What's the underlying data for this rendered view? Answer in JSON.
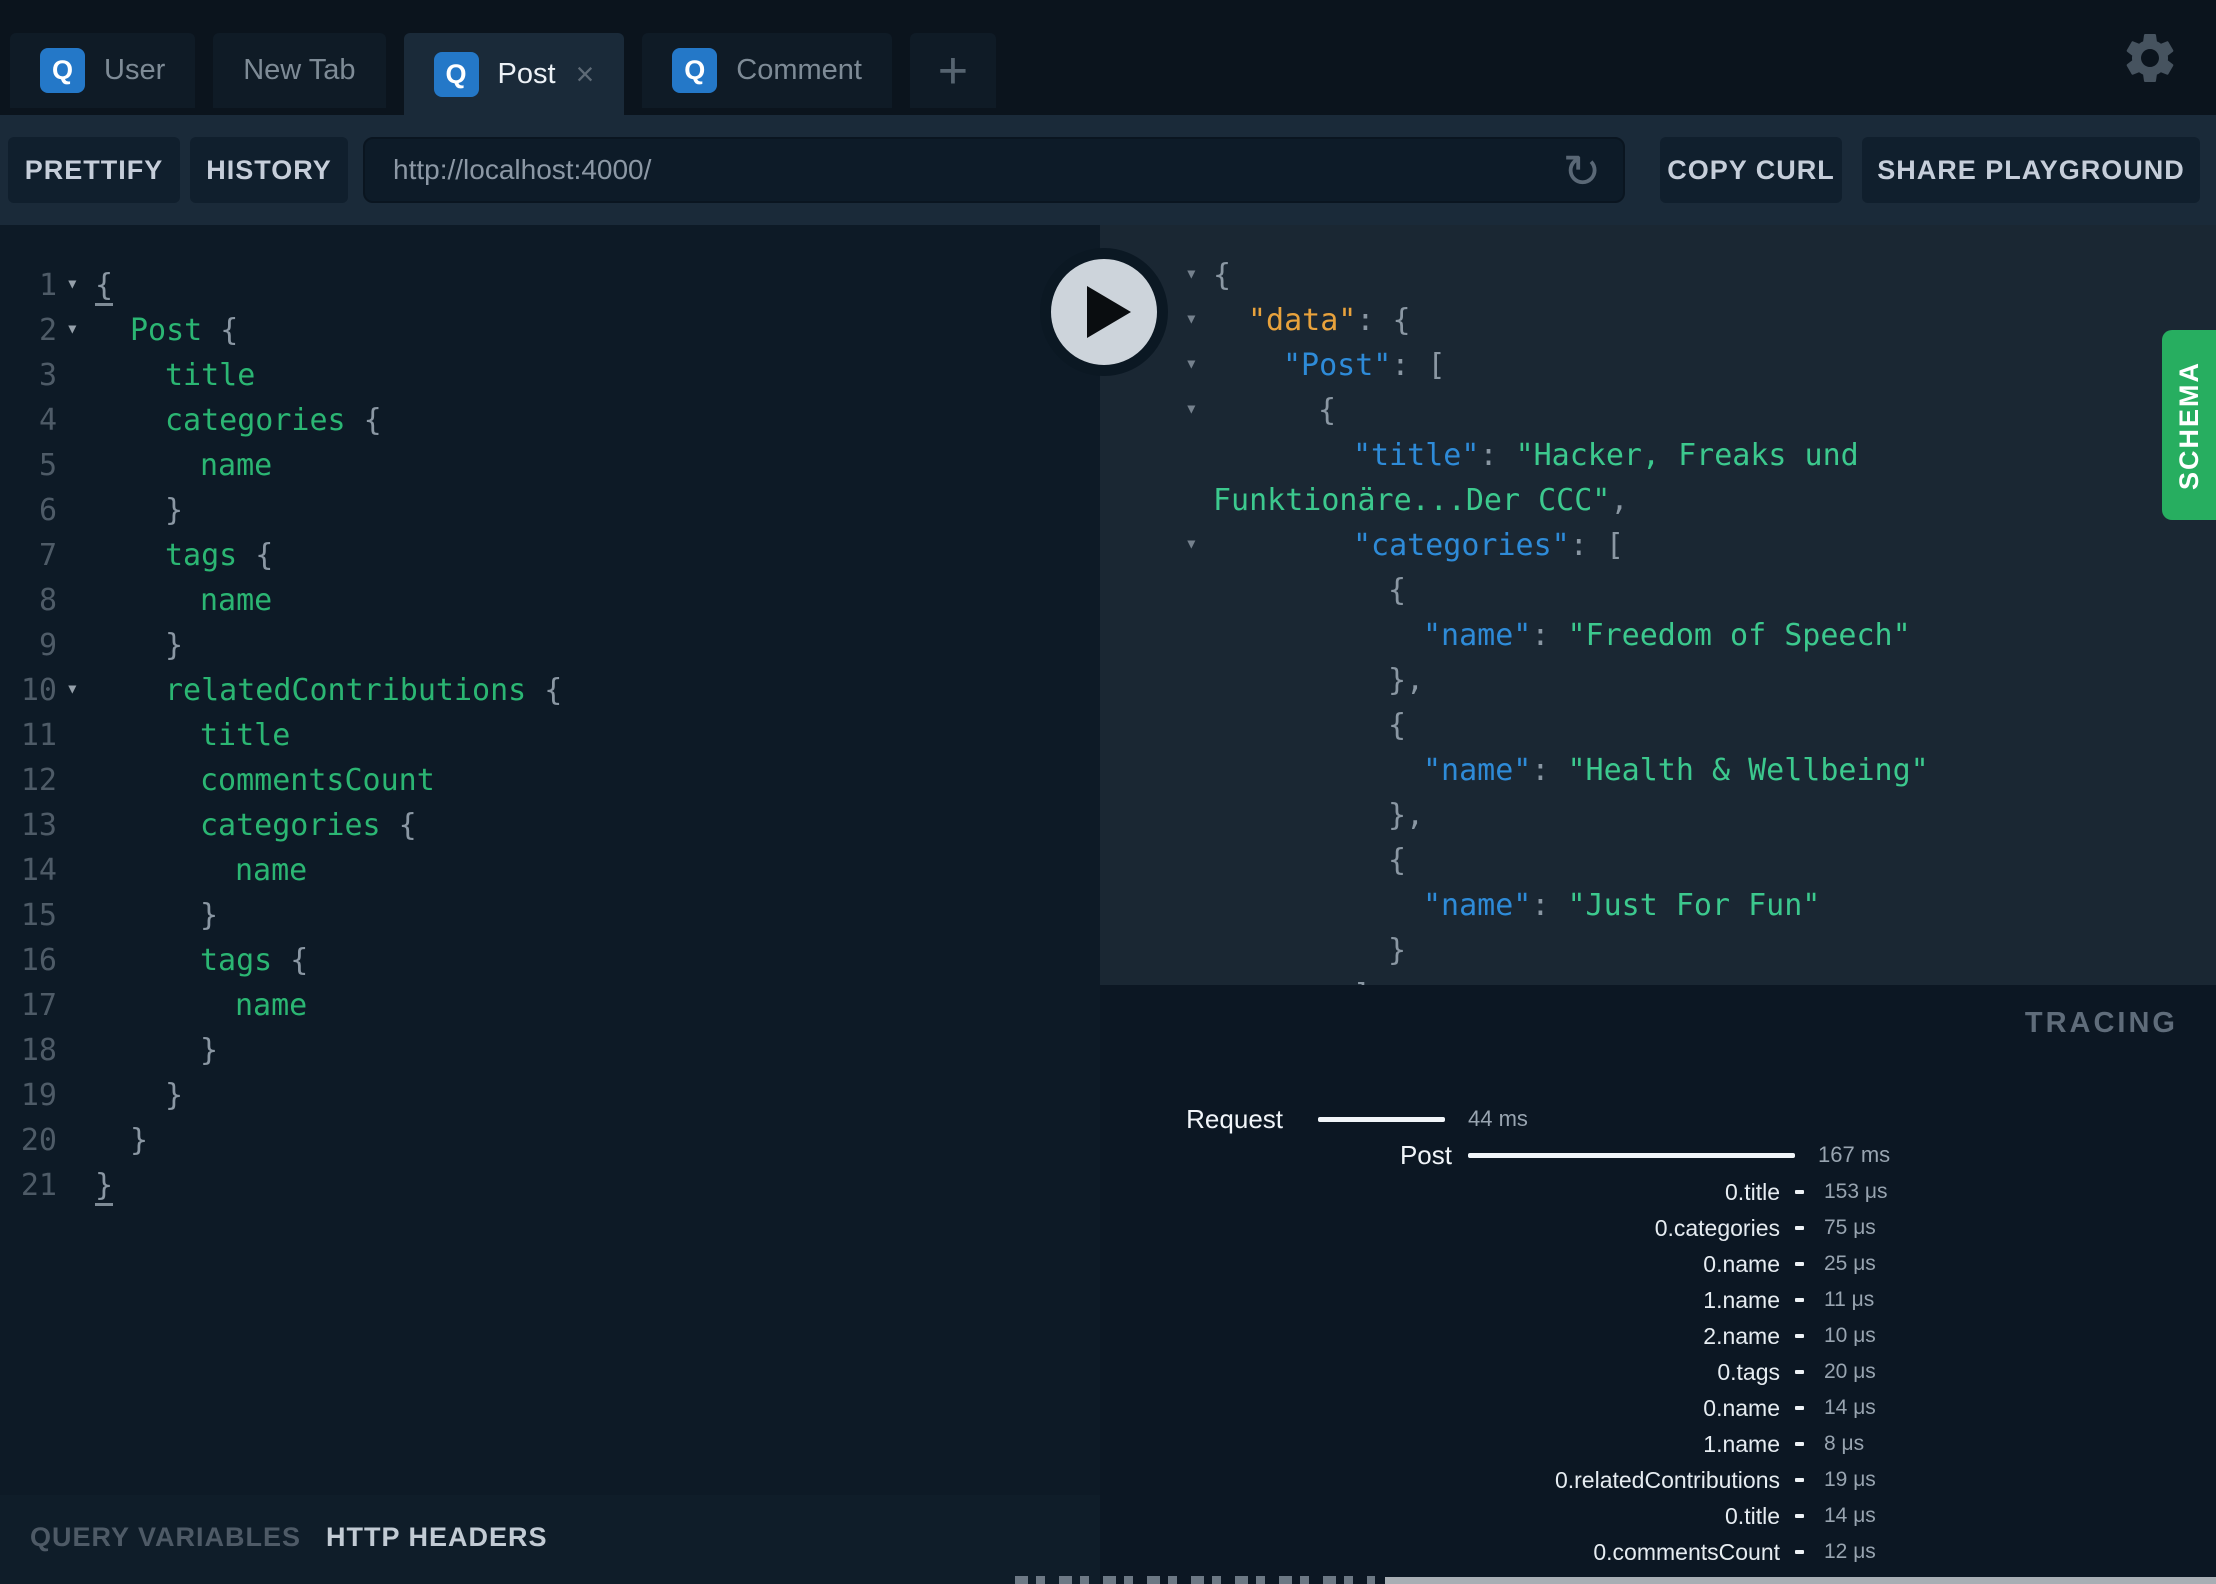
{
  "colors": {
    "schema_accent": "#27AE60",
    "operation_badge_blue": "#2478C8",
    "editor_field_green": "#2BB673",
    "json_string_green": "#3CC98E",
    "json_key_blue": "#2E8BD8",
    "json_data_key_orange": "#E8A23C",
    "punctuation_gray": "#8A97A3"
  },
  "tabbar": {
    "tabs": [
      {
        "label": "User",
        "badge": "Q",
        "active": false
      },
      {
        "label": "New Tab",
        "badge": null,
        "active": false
      },
      {
        "label": "Post",
        "badge": "Q",
        "active": true,
        "close": "×"
      },
      {
        "label": "Comment",
        "badge": "Q",
        "active": false
      }
    ],
    "new_tab_button": "+"
  },
  "toolbar": {
    "prettify_label": "PRETTIFY",
    "history_label": "HISTORY",
    "endpoint_url": "http://localhost:4000/",
    "refresh_icon": "↺",
    "copy_curl_label": "COPY CURL",
    "share_label": "SHARE PLAYGROUND"
  },
  "query_editor": {
    "lines": [
      {
        "n": 1,
        "a": 1,
        "i": 0,
        "s": [
          [
            "p",
            "{",
            1
          ]
        ]
      },
      {
        "n": 2,
        "a": 1,
        "i": 1,
        "s": [
          [
            "f",
            "Post"
          ],
          [
            "p",
            " {"
          ]
        ]
      },
      {
        "n": 3,
        "a": 0,
        "i": 2,
        "s": [
          [
            "f",
            "title"
          ]
        ]
      },
      {
        "n": 4,
        "a": 0,
        "i": 2,
        "s": [
          [
            "f",
            "categories"
          ],
          [
            "p",
            " {"
          ]
        ]
      },
      {
        "n": 5,
        "a": 0,
        "i": 3,
        "s": [
          [
            "f",
            "name"
          ]
        ]
      },
      {
        "n": 6,
        "a": 0,
        "i": 2,
        "s": [
          [
            "p",
            "}"
          ]
        ]
      },
      {
        "n": 7,
        "a": 0,
        "i": 2,
        "s": [
          [
            "f",
            "tags"
          ],
          [
            "p",
            " {"
          ]
        ]
      },
      {
        "n": 8,
        "a": 0,
        "i": 3,
        "s": [
          [
            "f",
            "name"
          ]
        ]
      },
      {
        "n": 9,
        "a": 0,
        "i": 2,
        "s": [
          [
            "p",
            "}"
          ]
        ]
      },
      {
        "n": 10,
        "a": 1,
        "i": 2,
        "s": [
          [
            "f",
            "relatedContributions"
          ],
          [
            "p",
            " {"
          ]
        ]
      },
      {
        "n": 11,
        "a": 0,
        "i": 3,
        "s": [
          [
            "f",
            "title"
          ]
        ]
      },
      {
        "n": 12,
        "a": 0,
        "i": 3,
        "s": [
          [
            "f",
            "commentsCount"
          ]
        ]
      },
      {
        "n": 13,
        "a": 0,
        "i": 3,
        "s": [
          [
            "f",
            "categories"
          ],
          [
            "p",
            " {"
          ]
        ]
      },
      {
        "n": 14,
        "a": 0,
        "i": 4,
        "s": [
          [
            "f",
            "name"
          ]
        ]
      },
      {
        "n": 15,
        "a": 0,
        "i": 3,
        "s": [
          [
            "p",
            "}"
          ]
        ]
      },
      {
        "n": 16,
        "a": 0,
        "i": 3,
        "s": [
          [
            "f",
            "tags"
          ],
          [
            "p",
            " {"
          ]
        ]
      },
      {
        "n": 17,
        "a": 0,
        "i": 4,
        "s": [
          [
            "f",
            "name"
          ]
        ]
      },
      {
        "n": 18,
        "a": 0,
        "i": 3,
        "s": [
          [
            "p",
            "}"
          ]
        ]
      },
      {
        "n": 19,
        "a": 0,
        "i": 2,
        "s": [
          [
            "p",
            "}"
          ]
        ]
      },
      {
        "n": 20,
        "a": 0,
        "i": 1,
        "s": [
          [
            "p",
            "}"
          ]
        ]
      },
      {
        "n": 21,
        "a": 0,
        "i": 0,
        "s": [
          [
            "p",
            "}",
            1
          ]
        ]
      }
    ]
  },
  "response": {
    "lines": [
      {
        "a": 1,
        "i": 0,
        "s": [
          [
            "p",
            "{"
          ]
        ]
      },
      {
        "a": 1,
        "i": 1,
        "s": [
          [
            "d",
            "\"data\""
          ],
          [
            "p",
            ": {"
          ]
        ]
      },
      {
        "a": 1,
        "i": 2,
        "s": [
          [
            "k",
            "\"Post\""
          ],
          [
            "p",
            ": ["
          ]
        ]
      },
      {
        "a": 1,
        "i": 3,
        "s": [
          [
            "p",
            "{"
          ]
        ]
      },
      {
        "a": 0,
        "i": 4,
        "s": [
          [
            "k",
            "\"title\""
          ],
          [
            "p",
            ": "
          ],
          [
            "s",
            "\"Hacker, Freaks und"
          ]
        ]
      },
      {
        "a": 0,
        "i": 0,
        "s": [
          [
            "s",
            "Funktionäre...Der CCC\""
          ],
          [
            "p",
            ","
          ]
        ]
      },
      {
        "a": 1,
        "i": 4,
        "s": [
          [
            "k",
            "\"categories\""
          ],
          [
            "p",
            ": ["
          ]
        ]
      },
      {
        "a": 0,
        "i": 5,
        "s": [
          [
            "p",
            "{"
          ]
        ]
      },
      {
        "a": 0,
        "i": 6,
        "s": [
          [
            "k",
            "\"name\""
          ],
          [
            "p",
            ": "
          ],
          [
            "s",
            "\"Freedom of Speech\""
          ]
        ]
      },
      {
        "a": 0,
        "i": 5,
        "s": [
          [
            "p",
            "},"
          ]
        ]
      },
      {
        "a": 0,
        "i": 5,
        "s": [
          [
            "p",
            "{"
          ]
        ]
      },
      {
        "a": 0,
        "i": 6,
        "s": [
          [
            "k",
            "\"name\""
          ],
          [
            "p",
            ": "
          ],
          [
            "s",
            "\"Health & Wellbeing\""
          ]
        ]
      },
      {
        "a": 0,
        "i": 5,
        "s": [
          [
            "p",
            "},"
          ]
        ]
      },
      {
        "a": 0,
        "i": 5,
        "s": [
          [
            "p",
            "{"
          ]
        ]
      },
      {
        "a": 0,
        "i": 6,
        "s": [
          [
            "k",
            "\"name\""
          ],
          [
            "p",
            ": "
          ],
          [
            "s",
            "\"Just For Fun\""
          ]
        ]
      },
      {
        "a": 0,
        "i": 5,
        "s": [
          [
            "p",
            "}"
          ]
        ]
      },
      {
        "a": 0,
        "i": 4,
        "s": [
          [
            "p",
            "]"
          ]
        ]
      }
    ]
  },
  "schema_tab": {
    "label": "SCHEMA"
  },
  "tracing": {
    "title": "TRACING",
    "request": {
      "label": "Request",
      "duration": "44 ms"
    },
    "root": {
      "label": "Post",
      "duration": "167 ms"
    },
    "fields": [
      {
        "label": "0.title",
        "duration": "153 μs"
      },
      {
        "label": "0.categories",
        "duration": "75 μs"
      },
      {
        "label": "0.name",
        "duration": "25 μs"
      },
      {
        "label": "1.name",
        "duration": "11 μs"
      },
      {
        "label": "2.name",
        "duration": "10 μs"
      },
      {
        "label": "0.tags",
        "duration": "20 μs"
      },
      {
        "label": "0.name",
        "duration": "14 μs"
      },
      {
        "label": "1.name",
        "duration": "8 μs"
      },
      {
        "label": "0.relatedContributions",
        "duration": "19 μs"
      },
      {
        "label": "0.title",
        "duration": "14 μs"
      },
      {
        "label": "0.commentsCount",
        "duration": "12 μs"
      }
    ]
  },
  "footer": {
    "query_variables_label": "QUERY VARIABLES",
    "http_headers_label": "HTTP HEADERS"
  }
}
